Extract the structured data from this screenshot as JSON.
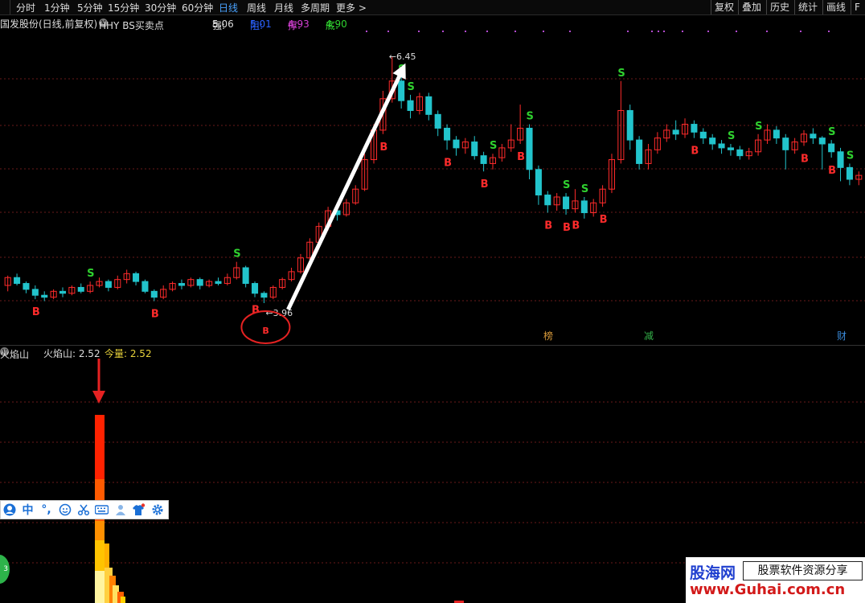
{
  "toolbar": {
    "timeframes": [
      "分时",
      "1分钟",
      "5分钟",
      "15分钟",
      "30分钟",
      "60分钟",
      "日线",
      "周线",
      "月线",
      "多周期",
      "更多"
    ],
    "active": "日线",
    "right_buttons": [
      "复权",
      "叠加",
      "历史",
      "统计",
      "画线",
      "F"
    ]
  },
  "chart_header": {
    "stock": "国发股份(日线,前复权)",
    "indicator": "HHY BS买卖点",
    "qiang_label": "强:",
    "qiang_value": "5.06",
    "zu_label": "阻:",
    "zu_value": "5.01",
    "cheng_label": "撑:",
    "cheng_value": "4.93",
    "di_label": "底:",
    "di_value": "4.90"
  },
  "colors": {
    "up": "#ff2b2b",
    "down": "#22c4cc",
    "grid": "#6a1a1a",
    "signal_buy": "#ff2b2b",
    "signal_sell": "#2fd12f",
    "accent": "#4aa3ff"
  },
  "chart_data": {
    "type": "candlestick",
    "high_label": "6.45",
    "low_label": "3.96",
    "candles": [
      [
        4.12,
        4.2,
        4.22,
        4.06
      ],
      [
        4.2,
        4.14,
        4.24,
        4.12
      ],
      [
        4.14,
        4.08,
        4.16,
        4.04
      ],
      [
        4.08,
        4.02,
        4.12,
        3.98
      ],
      [
        4.02,
        4.0,
        4.06,
        3.96
      ],
      [
        4.0,
        4.06,
        4.08,
        3.98
      ],
      [
        4.06,
        4.04,
        4.1,
        4.0
      ],
      [
        4.04,
        4.1,
        4.12,
        4.02
      ],
      [
        4.1,
        4.06,
        4.14,
        4.04
      ],
      [
        4.06,
        4.12,
        4.16,
        4.04
      ],
      [
        4.12,
        4.16,
        4.2,
        4.1
      ],
      [
        4.16,
        4.1,
        4.18,
        4.06
      ],
      [
        4.1,
        4.18,
        4.22,
        4.08
      ],
      [
        4.18,
        4.24,
        4.28,
        4.14
      ],
      [
        4.24,
        4.16,
        4.26,
        4.12
      ],
      [
        4.16,
        4.06,
        4.18,
        4.04
      ],
      [
        4.06,
        4.0,
        4.08,
        3.96
      ],
      [
        4.0,
        4.08,
        4.12,
        3.98
      ],
      [
        4.08,
        4.14,
        4.16,
        4.06
      ],
      [
        4.14,
        4.12,
        4.18,
        4.08
      ],
      [
        4.12,
        4.18,
        4.2,
        4.1
      ],
      [
        4.18,
        4.12,
        4.2,
        4.08
      ],
      [
        4.12,
        4.16,
        4.18,
        4.1
      ],
      [
        4.16,
        4.14,
        4.2,
        4.12
      ],
      [
        4.14,
        4.2,
        4.24,
        4.12
      ],
      [
        4.2,
        4.3,
        4.36,
        4.18
      ],
      [
        4.3,
        4.14,
        4.32,
        4.1
      ],
      [
        4.14,
        4.04,
        4.16,
        4.0
      ],
      [
        4.04,
        4.0,
        4.06,
        3.94
      ],
      [
        4.0,
        4.1,
        4.12,
        3.98
      ],
      [
        4.1,
        4.18,
        4.2,
        4.08
      ],
      [
        4.18,
        4.26,
        4.3,
        4.16
      ],
      [
        4.26,
        4.4,
        4.44,
        4.24
      ],
      [
        4.4,
        4.56,
        4.6,
        4.38
      ],
      [
        4.56,
        4.72,
        4.76,
        4.52
      ],
      [
        4.72,
        4.88,
        4.92,
        4.68
      ],
      [
        4.88,
        4.84,
        4.94,
        4.78
      ],
      [
        4.84,
        4.96,
        5.0,
        4.82
      ],
      [
        4.96,
        5.1,
        5.14,
        4.94
      ],
      [
        5.1,
        5.4,
        5.46,
        5.08
      ],
      [
        5.4,
        5.7,
        5.76,
        5.36
      ],
      [
        5.7,
        6.02,
        6.1,
        5.66
      ],
      [
        6.02,
        6.2,
        6.45,
        5.98
      ],
      [
        6.2,
        6.0,
        6.24,
        5.92
      ],
      [
        6.0,
        5.9,
        6.06,
        5.82
      ],
      [
        5.9,
        6.04,
        6.08,
        5.86
      ],
      [
        6.04,
        5.86,
        6.08,
        5.8
      ],
      [
        5.86,
        5.72,
        5.9,
        5.64
      ],
      [
        5.72,
        5.6,
        5.76,
        5.5
      ],
      [
        5.6,
        5.52,
        5.64,
        5.44
      ],
      [
        5.52,
        5.58,
        5.62,
        5.46
      ],
      [
        5.58,
        5.44,
        5.64,
        5.4
      ],
      [
        5.44,
        5.36,
        5.48,
        5.28
      ],
      [
        5.36,
        5.42,
        5.46,
        5.3
      ],
      [
        5.42,
        5.52,
        5.56,
        5.38
      ],
      [
        5.52,
        5.6,
        5.76,
        5.48
      ],
      [
        5.6,
        5.72,
        5.96,
        5.56
      ],
      [
        5.72,
        5.3,
        5.76,
        5.2
      ],
      [
        5.3,
        5.04,
        5.34,
        4.94
      ],
      [
        5.04,
        4.94,
        5.08,
        4.86
      ],
      [
        4.94,
        5.02,
        5.06,
        4.88
      ],
      [
        5.02,
        4.9,
        5.06,
        4.84
      ],
      [
        4.9,
        4.98,
        5.1,
        4.86
      ],
      [
        4.98,
        4.86,
        5.02,
        4.8
      ],
      [
        4.86,
        4.96,
        5.0,
        4.82
      ],
      [
        4.96,
        5.1,
        5.14,
        4.92
      ],
      [
        5.1,
        5.4,
        5.46,
        5.06
      ],
      [
        5.4,
        5.9,
        6.2,
        5.36
      ],
      [
        5.9,
        5.6,
        5.96,
        5.5
      ],
      [
        5.6,
        5.36,
        5.64,
        5.3
      ],
      [
        5.36,
        5.5,
        5.56,
        5.3
      ],
      [
        5.5,
        5.62,
        5.68,
        5.46
      ],
      [
        5.62,
        5.7,
        5.76,
        5.58
      ],
      [
        5.7,
        5.66,
        5.8,
        5.6
      ],
      [
        5.66,
        5.76,
        5.82,
        5.62
      ],
      [
        5.76,
        5.68,
        5.8,
        5.62
      ],
      [
        5.68,
        5.62,
        5.72,
        5.56
      ],
      [
        5.62,
        5.56,
        5.66,
        5.5
      ],
      [
        5.56,
        5.52,
        5.6,
        5.46
      ],
      [
        5.52,
        5.5,
        5.56,
        5.44
      ],
      [
        5.5,
        5.44,
        5.54,
        5.4
      ],
      [
        5.44,
        5.48,
        5.52,
        5.4
      ],
      [
        5.48,
        5.6,
        5.66,
        5.44
      ],
      [
        5.6,
        5.7,
        5.76,
        5.56
      ],
      [
        5.7,
        5.62,
        5.74,
        5.56
      ],
      [
        5.62,
        5.5,
        5.66,
        5.3
      ],
      [
        5.5,
        5.58,
        5.62,
        5.46
      ],
      [
        5.58,
        5.66,
        5.7,
        5.54
      ],
      [
        5.66,
        5.62,
        5.72,
        5.56
      ],
      [
        5.62,
        5.56,
        5.64,
        5.3
      ],
      [
        5.56,
        5.48,
        5.6,
        5.42
      ],
      [
        5.48,
        5.32,
        5.52,
        5.18
      ],
      [
        5.32,
        5.2,
        5.36,
        5.14
      ],
      [
        5.2,
        5.24,
        5.28,
        5.14
      ]
    ],
    "buy_signals": [
      3,
      16,
      27,
      41,
      48,
      52,
      56,
      59,
      61,
      62,
      65,
      75,
      87,
      90
    ],
    "sell_signals": [
      9,
      25,
      43,
      44,
      53,
      57,
      61,
      63,
      67,
      79,
      82,
      90,
      92
    ],
    "sub_panel_title": "火焰山",
    "sub_series_label": "火焰山: 2.52",
    "sub_volume_label": "今量: 2.52",
    "events": [
      "榜",
      "减",
      "财"
    ]
  },
  "ime_toolbar": {
    "lang": "中",
    "punct": "°,"
  }
}
